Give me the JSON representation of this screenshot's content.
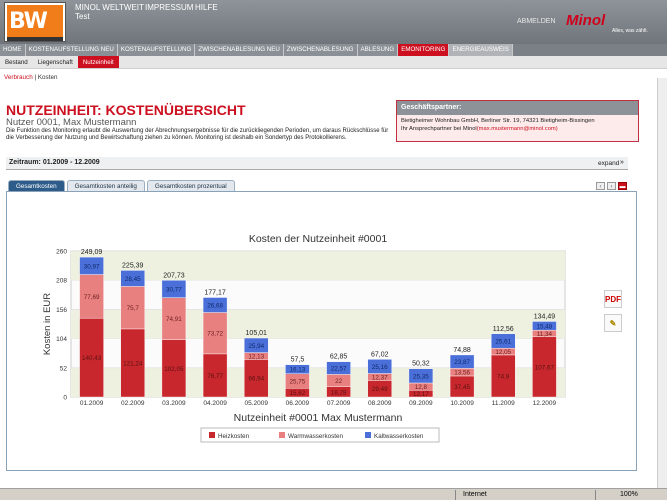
{
  "header": {
    "logo_text": "BW",
    "links": [
      "MINOL WELTWEIT",
      "IMPRESSUM",
      "HILFE"
    ],
    "username": "Test",
    "logout": "ABMELDEN",
    "brand": "Minol",
    "slogan": "Alles, was zählt."
  },
  "nav": {
    "items": [
      "HOME",
      "KOSTENAUFSTELLUNG NEU",
      "KOSTENAUFSTELLUNG",
      "ZWISCHENABLESUNG NEU",
      "ZWISCHENABLESUNG",
      "ABLESUNG",
      "EMONITORING",
      "ENERGIEAUSWEIS"
    ],
    "active_index": 6
  },
  "subnav": {
    "items": [
      "Bestand",
      "Liegenschaft",
      "Nutzeinheit"
    ],
    "active_index": 2
  },
  "breadcrumb": {
    "first": "Verbrauch",
    "sep": "|",
    "second": "Kosten"
  },
  "main": {
    "title": "NUTZEINHEIT: KOSTENÜBERSICHT",
    "user": "Nutzer 0001, Max Mustermann",
    "description": "Die Funktion des Monitoring erlaubt die Auswertung der Abrechnungsergebnisse für die zurückliegenden Perioden, um daraus Rückschlüsse für die Verbesserung der Nutzung und Bewirtschaftung ziehen zu können. Monitoring ist deshalb ein Sondertyp des Protokollierens."
  },
  "partner": {
    "header": "Geschäftspartner:",
    "line1": "Bietigheimer Wohnbau GmbH, Berliner Str. 19, 74321 Bietigheim-Bissingen",
    "line2": "Ihr Ansprechpartner bei Minol",
    "email": "(max.mustermann@minol.com)"
  },
  "period": {
    "label": "Zeitraum: 01.2009 - 12.2009",
    "expand": "expand",
    "chevron": "»"
  },
  "tabs": [
    "Gesamtkosten",
    "Gesamtkosten anteilig",
    "Gesamtkosten prozentual"
  ],
  "tab_controls": [
    "‹",
    "›",
    "▬"
  ],
  "side_icons": [
    "pdf-icon",
    "export-icon"
  ],
  "side_icon_glyphs": [
    "PDF",
    "✎"
  ],
  "status": {
    "zone": "Internet",
    "zoom": "100%"
  },
  "colors": {
    "heat": "#c8282d",
    "warm": "#e88080",
    "cold": "#4a6fd8",
    "accent": "#cc1020"
  },
  "chart_data": {
    "type": "bar",
    "stacked": true,
    "title": "Kosten der Nutzeinheit #0001",
    "xlabel": "Nutzeinheit #0001 Max Mustermann",
    "ylabel": "Kosten in EUR",
    "ylim": [
      0,
      260
    ],
    "yticks": [
      0,
      52,
      104,
      156,
      208,
      260
    ],
    "categories": [
      "01.2009",
      "02.2009",
      "03.2009",
      "04.2009",
      "05.2009",
      "06.2009",
      "07.2009",
      "08.2009",
      "09.2009",
      "10.2009",
      "11.2009",
      "12.2009"
    ],
    "totals": [
      "249,09",
      "225,39",
      "207,73",
      "177,17",
      "105,01",
      "57,5",
      "62,85",
      "67,02",
      "50,32",
      "74,88",
      "112,56",
      "134,49"
    ],
    "series": [
      {
        "name": "Heizkosten",
        "values": [
          140.43,
          121.24,
          102.05,
          76.77,
          66.94,
          15.62,
          18.28,
          29.49,
          12.17,
          37.45,
          74.9,
          107.67
        ],
        "labels": [
          "140,43",
          "121,24",
          "102,05",
          "76,77",
          "66,94",
          "15,62",
          "18,28",
          "29,49",
          "12,17",
          "37,45",
          "74,9",
          "107,67"
        ]
      },
      {
        "name": "Warmwasserkosten",
        "values": [
          77.69,
          75.7,
          74.91,
          73.72,
          12.13,
          25.75,
          22.0,
          12.37,
          12.8,
          13.56,
          12.05,
          11.34
        ],
        "labels": [
          "77,69",
          "75,7",
          "74,91",
          "73,72",
          "12,13",
          "25,75",
          "22",
          "12,37",
          "12,8",
          "13,56",
          "12,05",
          "11,34"
        ]
      },
      {
        "name": "Kaltwasserkosten",
        "values": [
          30.97,
          28.45,
          30.77,
          26.68,
          25.94,
          16.13,
          22.57,
          25.16,
          25.35,
          23.87,
          25.61,
          15.48
        ],
        "labels": [
          "30,97",
          "28,45",
          "30,77",
          "26,68",
          "25,94",
          "16,13",
          "22,57",
          "25,16",
          "25,35",
          "23,87",
          "25,61",
          "15,48"
        ]
      }
    ],
    "legend_position": "bottom",
    "grid": true
  }
}
